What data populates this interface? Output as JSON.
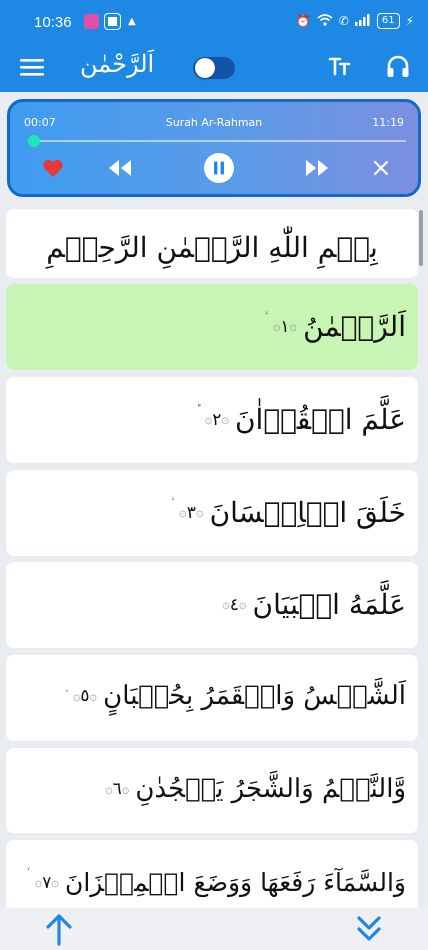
{
  "status_bar": {
    "time": "10:36",
    "battery": "61"
  },
  "app_bar": {
    "title": "اَلرَّحْمٰن"
  },
  "player": {
    "current_time": "00:07",
    "track_title": "Surah Ar-Rahman",
    "duration": "11:19",
    "progress_fraction": 0.01
  },
  "verses": {
    "bismillah": "بِسۡمِ اللّٰهِ الرَّحۡمٰنِ الرَّحِيۡمِ",
    "items": [
      {
        "text": "اَلرَّحۡمٰنُ",
        "number": "١",
        "mark": "ۙ"
      },
      {
        "text": "عَلَّمَ الۡقُرۡاٰنَ",
        "number": "٢",
        "mark": "ؕ"
      },
      {
        "text": "خَلَقَ الۡاِنۡسَانَ",
        "number": "٣",
        "mark": "ۙ"
      },
      {
        "text": "عَلَّمَهُ الۡبَيَانَ",
        "number": "٤",
        "mark": ""
      },
      {
        "text": "اَلشَّمۡسُ وَالۡقَمَرُ بِحُسۡبَانٍ",
        "number": "٥",
        "mark": "۪"
      },
      {
        "text": "وَّالنَّجۡمُ وَالشَّجَرُ يَسۡجُدٰنِ",
        "number": "٦",
        "mark": ""
      },
      {
        "text": "وَالسَّمَآءَ رَفَعَهَا وَوَضَعَ الۡمِيۡزَانَ",
        "number": "٧",
        "mark": "ۙ"
      }
    ]
  }
}
